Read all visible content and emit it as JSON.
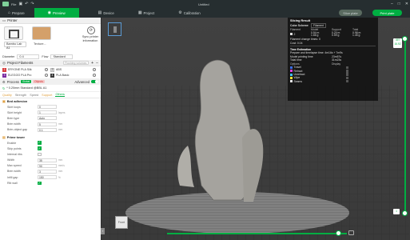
{
  "titlebar": {
    "menu": "File",
    "title": "Untitled"
  },
  "nav": {
    "tabs": [
      {
        "label": "Prepare",
        "icon": "⌂"
      },
      {
        "label": "Preview",
        "icon": "◉"
      },
      {
        "label": "Device",
        "icon": "▤"
      },
      {
        "label": "Project",
        "icon": "▦"
      },
      {
        "label": "Calibration",
        "icon": "⚙"
      }
    ],
    "slice_label": "Slice plate",
    "print_label": "Print plate"
  },
  "printer": {
    "section_title": "Printer",
    "name": "Bambu Lab A1",
    "plate_name": "Texture...",
    "sync_label": "Sync printer information",
    "diameter_label": "Diameter",
    "diameter_value": "0.4",
    "flow_label": "Flow",
    "flow_value": "Standard"
  },
  "filaments": {
    "section_title": "Project Filaments",
    "select_placeholder": "Flushing volumes",
    "items": [
      {
        "num": "1",
        "name": "ERYONE PLA Silk",
        "color": "#d94040"
      },
      {
        "num": "2",
        "name": "ABS",
        "color": "#e0e0e0",
        "textcolor": "#333"
      },
      {
        "num": "3",
        "name": "ELEGOO PLA Pro",
        "color": "#7a2aa0"
      },
      {
        "num": "4",
        "name": "PLA Basic",
        "color": "#3a3a3a"
      }
    ]
  },
  "process": {
    "section_title": "Process",
    "badge_global": "Global",
    "badge_object": "Objects",
    "advanced_label": "Advanced",
    "preset": "* 0.20mm Standard @BBL A1",
    "tabs": [
      "Quality",
      "Strength",
      "Speed",
      "Support",
      "Others"
    ],
    "active_tab": "Others"
  },
  "settings": {
    "bed_adhesion": {
      "title": "Bed adhesion",
      "rows": [
        {
          "label": "Skirt loops",
          "value": "0",
          "unit": ""
        },
        {
          "label": "Skirt height",
          "value": "1",
          "unit": "layers"
        },
        {
          "label": "Brim type",
          "value": "Auto",
          "unit": ""
        },
        {
          "label": "Brim width",
          "value": "5",
          "unit": "mm"
        },
        {
          "label": "Brim-object gap",
          "value": "0.1",
          "unit": "mm"
        }
      ]
    },
    "prime_tower": {
      "title": "Prime tower",
      "rows": [
        {
          "label": "Enable",
          "check": true
        },
        {
          "label": "Skip points",
          "check": true
        },
        {
          "label": "Internal ribs",
          "check": false
        },
        {
          "label": "Width",
          "value": "35",
          "unit": "mm"
        },
        {
          "label": "Max speed",
          "value": "90",
          "unit": "mm/s"
        },
        {
          "label": "Brim width",
          "value": "3",
          "unit": "mm"
        },
        {
          "label": "Infill gap",
          "value": "150",
          "unit": "%"
        },
        {
          "label": "Rib wall",
          "check": true
        }
      ]
    }
  },
  "result": {
    "title": "Slicing Result",
    "scheme_label": "Color Scheme",
    "scheme_value": "Filament",
    "headers": [
      "Filament",
      "Model",
      "Support",
      "Total"
    ],
    "row": {
      "name": "2",
      "model": "0.54 m\n1.66 g",
      "support": "0.24 m\n0.59 g",
      "total": "0.98 m\n1.45 g"
    },
    "changes": "Filament change times: 0",
    "cost": "Cost: 0.04",
    "time_title": "Time Estimation",
    "prepare": "Prepare and timelapse time: 4m16s + 7m9s",
    "model_time_label": "Model printing time",
    "model_time": "23m57s",
    "total_label": "Total time",
    "total_time": "31m23s",
    "options_header": "Options",
    "display_header": "Display",
    "options": [
      {
        "name": "Travel",
        "color": "#3a6ee8"
      },
      {
        "name": "Retract",
        "color": "#e040e0"
      },
      {
        "name": "Unretract",
        "color": "#40c0ff"
      },
      {
        "name": "Wipe",
        "color": "#f0e030"
      },
      {
        "name": "Seams",
        "color": "#e8e8e8"
      }
    ]
  },
  "sliders": {
    "top_layer": "397",
    "top_height": "16.92",
    "bottom_layer": "1"
  },
  "cube_label": "Front"
}
